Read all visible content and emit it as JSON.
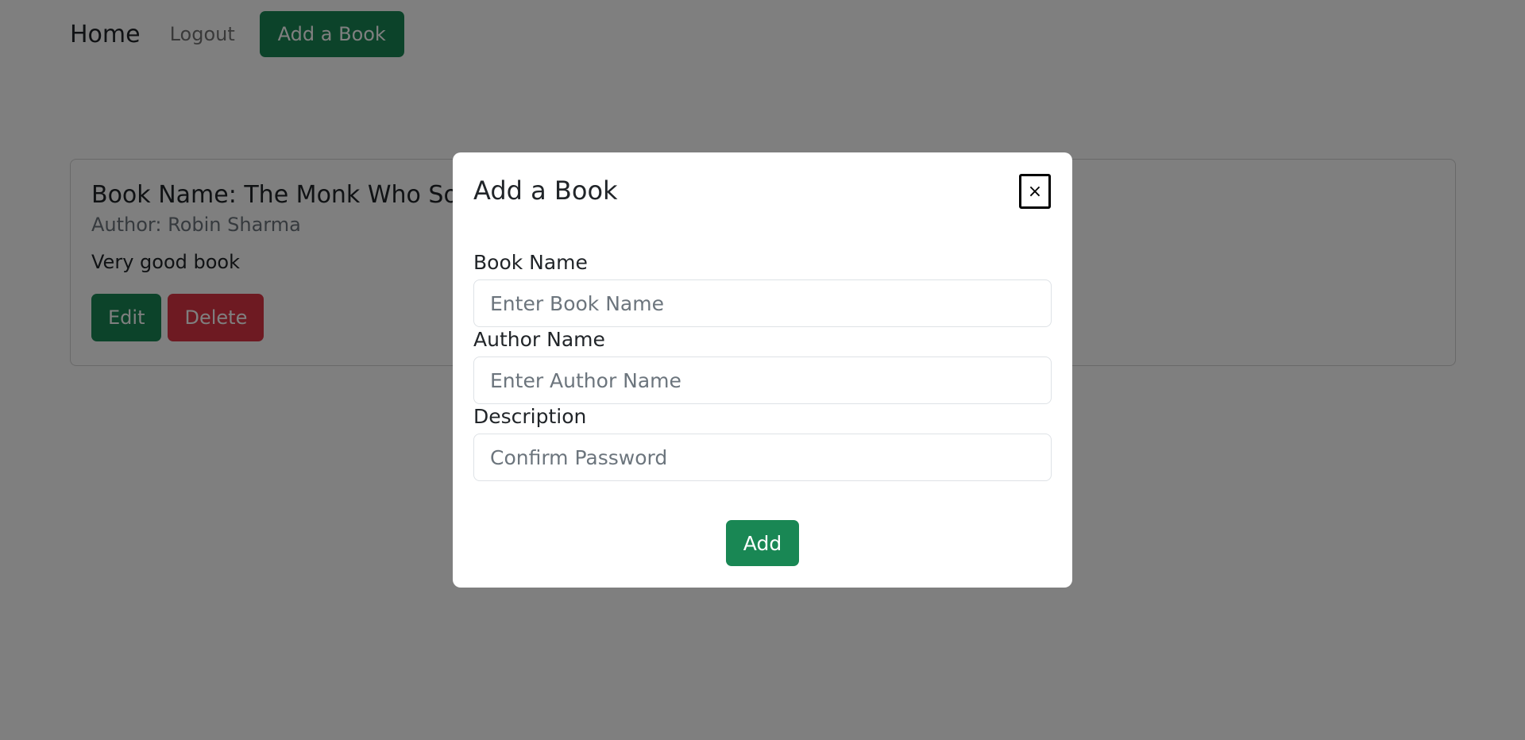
{
  "navbar": {
    "brand": "Home",
    "logout": "Logout",
    "add_book": "Add a Book"
  },
  "book_card": {
    "title": "Book Name: The Monk Who Sold His Ferrari",
    "author": "Author: Robin Sharma",
    "description": "Very good book",
    "edit_label": "Edit",
    "delete_label": "Delete"
  },
  "modal": {
    "title": "Add a Book",
    "close_label": "×",
    "book_name_label": "Book Name",
    "book_name_placeholder": "Enter Book Name",
    "author_name_label": "Author Name",
    "author_name_placeholder": "Enter Author Name",
    "description_label": "Description",
    "description_placeholder": "Confirm Password",
    "submit_label": "Add"
  },
  "colors": {
    "success": "#198754",
    "danger": "#dc3545",
    "backdrop": "rgba(0,0,0,0.5)"
  }
}
